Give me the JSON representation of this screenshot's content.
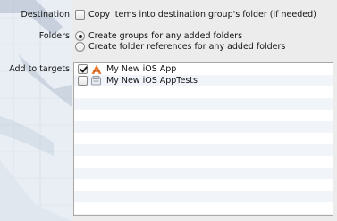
{
  "destination": {
    "label": "Destination",
    "copy_items_label": "Copy items into destination group's folder (if needed)",
    "copy_items_checked": false
  },
  "folders": {
    "label": "Folders",
    "options": [
      {
        "label": "Create groups for any added folders",
        "selected": true
      },
      {
        "label": "Create folder references for any added folders",
        "selected": false
      }
    ]
  },
  "targets": {
    "label": "Add to targets",
    "items": [
      {
        "name": "My New iOS App",
        "checked": true,
        "icon": "app-target-icon"
      },
      {
        "name": "My New iOS AppTests",
        "checked": false,
        "icon": "test-bundle-icon"
      }
    ]
  },
  "colors": {
    "list_stripe": "#f1f5fa",
    "window_bg": "#ececec"
  }
}
